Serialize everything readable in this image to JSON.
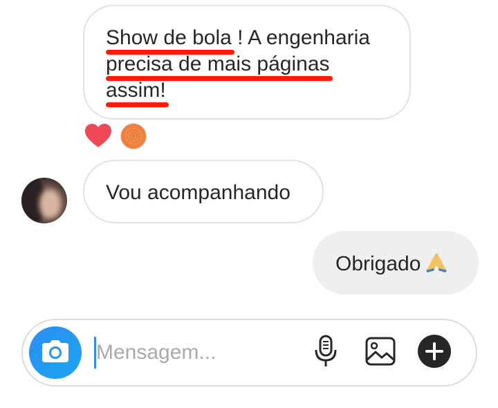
{
  "conversation": {
    "messages": [
      {
        "from": "me-previous",
        "lines": [
          {
            "underlined": "Show de bola",
            "rest": " ! A engenharia"
          },
          {
            "underlined": "precisa de mais páginas",
            "rest": ""
          },
          {
            "underlined": "assim!",
            "rest": ""
          }
        ]
      },
      {
        "from": "contact",
        "text": "Vou acompanhando"
      },
      {
        "from": "me",
        "text": "Obrigado",
        "emoji": "🙏"
      }
    ],
    "reactions": [
      "heart-icon",
      "reaction-face-icon"
    ],
    "colors": {
      "highlight": "#ff1a00",
      "heart": "#ed4956",
      "accent": "#2f8cf2",
      "outgoing_bubble": "#efefef"
    }
  },
  "composer": {
    "placeholder": "Mensagem...",
    "value": "",
    "icons": [
      "camera-icon",
      "microphone-icon",
      "gallery-icon",
      "plus-icon"
    ]
  }
}
